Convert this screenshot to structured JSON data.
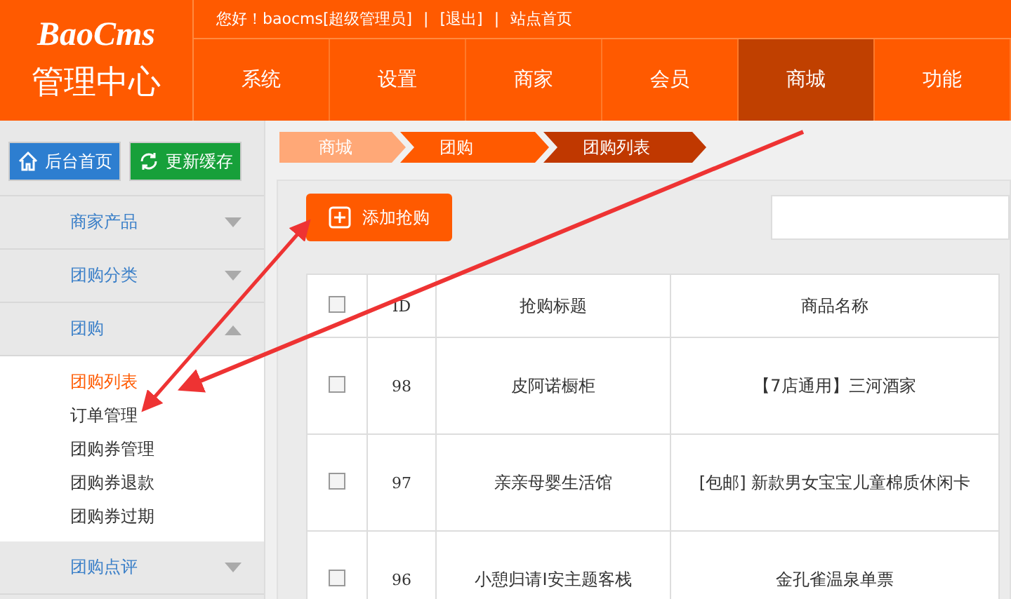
{
  "logo": {
    "brand": "BaoCms",
    "subtitle": "管理中心"
  },
  "top_bar": {
    "greeting": "您好！baocms[超级管理员]",
    "separators": [
      "|",
      "|"
    ],
    "links": [
      "[退出]",
      "站点首页"
    ]
  },
  "nav": [
    {
      "label": "系统",
      "selected": false
    },
    {
      "label": "设置",
      "selected": false
    },
    {
      "label": "商家",
      "selected": false
    },
    {
      "label": "会员",
      "selected": false
    },
    {
      "label": "商城",
      "selected": true
    },
    {
      "label": "功能",
      "selected": false
    }
  ],
  "sidebar": {
    "buttons": [
      {
        "kind": "home",
        "label": "后台首页"
      },
      {
        "kind": "refresh",
        "label": "更新缓存"
      }
    ],
    "items": [
      {
        "label": "商家产品",
        "expanded": false
      },
      {
        "label": "团购分类",
        "expanded": false
      },
      {
        "label": "团购",
        "expanded": true,
        "children": [
          {
            "label": "团购列表",
            "selected": true
          },
          {
            "label": "订单管理",
            "selected": false
          },
          {
            "label": "团购券管理",
            "selected": false
          },
          {
            "label": "团购券退款",
            "selected": false
          },
          {
            "label": "团购券过期",
            "selected": false
          }
        ]
      },
      {
        "label": "团购点评",
        "expanded": false
      }
    ]
  },
  "breadcrumb": [
    "商城",
    "团购",
    "团购列表"
  ],
  "toolbar": {
    "add_button": "添加抢购"
  },
  "table": {
    "select_all_checked": false,
    "columns": [
      "ID",
      "抢购标题",
      "商品名称"
    ],
    "rows": [
      {
        "checked": false,
        "cells": [
          "98",
          "皮阿诺橱柜",
          "【7店通用】三河酒家"
        ]
      },
      {
        "checked": false,
        "cells": [
          "97",
          "亲亲母婴生活馆",
          "[包邮] 新款男女宝宝儿童棉质休闲卡"
        ]
      },
      {
        "checked": false,
        "cells": [
          "96",
          "小憩归请I安主题客栈",
          "金孔雀温泉单票"
        ]
      }
    ]
  }
}
